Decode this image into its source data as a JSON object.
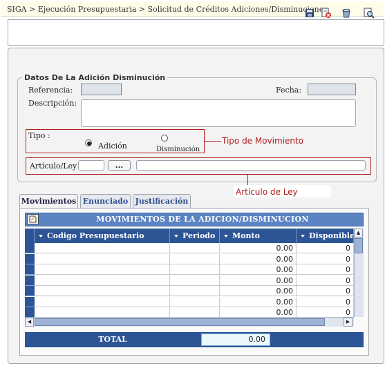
{
  "breadcrumb": "SIGA > Ejecución Presupuestaria > Solicitud de Créditos Adiciones/Disminuciones",
  "toolbar": {
    "icons": [
      "save-icon",
      "delete-icon",
      "bucket-icon",
      "preview-icon"
    ]
  },
  "section": {
    "legend": "Datos De La Adición Disminución",
    "referencia_label": "Referencia:",
    "referencia_value": "",
    "fecha_label": "Fecha:",
    "fecha_value": "",
    "descripcion_label": "Descripción:",
    "descripcion_value": "",
    "tipo_label": "Tipo :",
    "tipo_options": [
      "Adición",
      "Disminución"
    ],
    "tipo_selected": "Adición",
    "articulo_label": "Artículo/Ley",
    "articulo_code": "",
    "articulo_button": "...",
    "articulo_desc": ""
  },
  "annotations": {
    "tipo": "Tipo de Movimiento",
    "articulo": "Artículo de Ley"
  },
  "tabs": [
    "Movimientos",
    "Enunciado",
    "Justificación"
  ],
  "active_tab": "Movimientos",
  "grid": {
    "title": "MOVIMIENTOS DE LA ADICION/DISMINUCION",
    "columns": [
      "Codigo Presupuestario",
      "Periodo",
      "Monto",
      "Disponible"
    ],
    "rows": [
      {
        "codigo": "",
        "periodo": "",
        "monto": "0.00",
        "disponible": "0"
      },
      {
        "codigo": "",
        "periodo": "",
        "monto": "0.00",
        "disponible": "0"
      },
      {
        "codigo": "",
        "periodo": "",
        "monto": "0.00",
        "disponible": "0"
      },
      {
        "codigo": "",
        "periodo": "",
        "monto": "0.00",
        "disponible": "0"
      },
      {
        "codigo": "",
        "periodo": "",
        "monto": "0.00",
        "disponible": "0"
      },
      {
        "codigo": "",
        "periodo": "",
        "monto": "0.00",
        "disponible": "0"
      },
      {
        "codigo": "",
        "periodo": "",
        "monto": "0.00",
        "disponible": "0"
      }
    ]
  },
  "total": {
    "label": "TOTAL",
    "value": "0.00"
  }
}
